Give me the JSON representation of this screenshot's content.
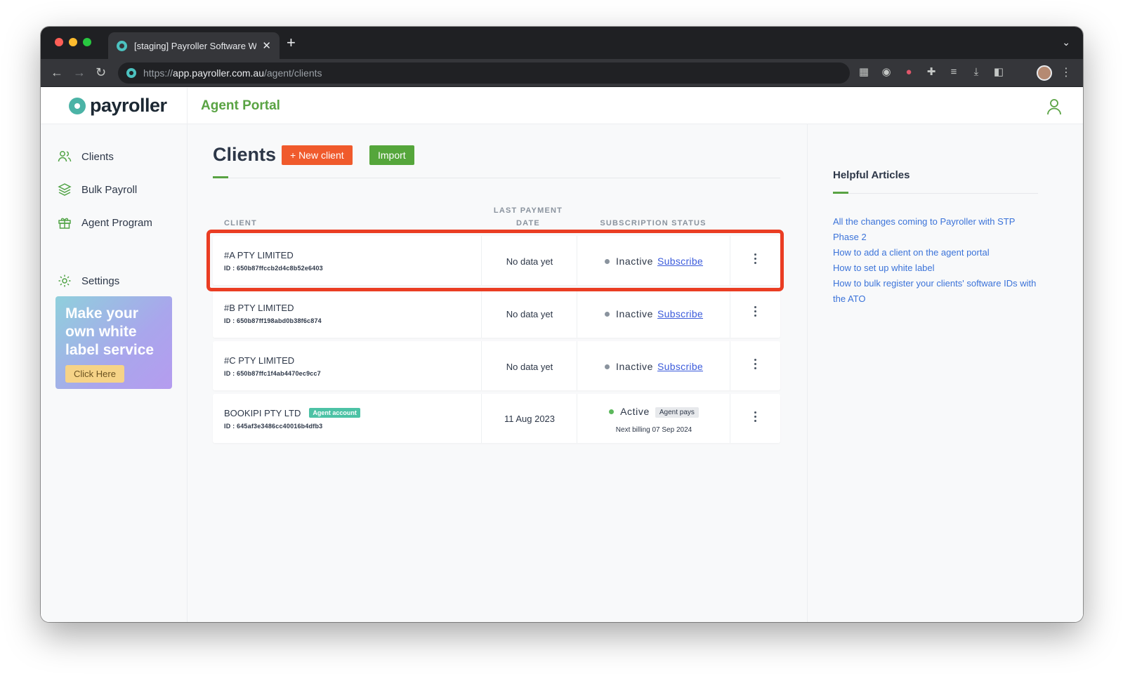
{
  "browser": {
    "tab_title": "[staging] Payroller Software Web",
    "tab_close": "✕",
    "new_tab": "+",
    "url_scheme": "https://",
    "url_host": "app.payroller.com.au",
    "url_path": "/agent/clients"
  },
  "brand": {
    "logo_text": "payroller",
    "accent": "#59a343"
  },
  "topbar": {
    "portal_title": "Agent Portal"
  },
  "sidebar": {
    "items": [
      {
        "label": "Clients",
        "icon": "users-icon"
      },
      {
        "label": "Bulk Payroll",
        "icon": "layers-icon"
      },
      {
        "label": "Agent Program",
        "icon": "gift-icon"
      },
      {
        "label": "Settings",
        "icon": "gear-icon"
      }
    ],
    "promo": {
      "title": "Make your own white label service",
      "button": "Click Here"
    }
  },
  "clients": {
    "title": "Clients",
    "new_client_label": "+ New client",
    "import_label": "Import",
    "columns": {
      "client": "CLIENT",
      "last_payment_date": "LAST PAYMENT DATE",
      "subscription_status": "SUBSCRIPTION STATUS"
    },
    "rows": [
      {
        "name": "#A PTY LIMITED",
        "id": "ID : 650b87ffccb2d4c8b52e6403",
        "last_payment": "No data yet",
        "status": "Inactive",
        "action": "Subscribe",
        "badge": "",
        "billing": "",
        "agent_pays": ""
      },
      {
        "name": "#B PTY LIMITED",
        "id": "ID : 650b87ff198abd0b38f6c874",
        "last_payment": "No data yet",
        "status": "Inactive",
        "action": "Subscribe",
        "badge": "",
        "billing": "",
        "agent_pays": ""
      },
      {
        "name": "#C PTY LIMITED",
        "id": "ID : 650b87ffc1f4ab4470ec9cc7",
        "last_payment": "No data yet",
        "status": "Inactive",
        "action": "Subscribe",
        "badge": "",
        "billing": "",
        "agent_pays": ""
      },
      {
        "name": "BOOKIPI PTY LTD",
        "id": "ID : 645af3e3486cc40016b4dfb3",
        "last_payment": "11 Aug 2023",
        "status": "Active",
        "action": "",
        "badge": "Agent account",
        "billing": "Next billing 07 Sep 2024",
        "agent_pays": "Agent pays"
      }
    ]
  },
  "helpful_articles": {
    "title": "Helpful Articles",
    "links": [
      "All the changes coming to Payroller with STP Phase 2",
      "How to add a client on the agent portal",
      "How to set up white label",
      "How to bulk register your clients' software IDs with the ATO"
    ]
  }
}
